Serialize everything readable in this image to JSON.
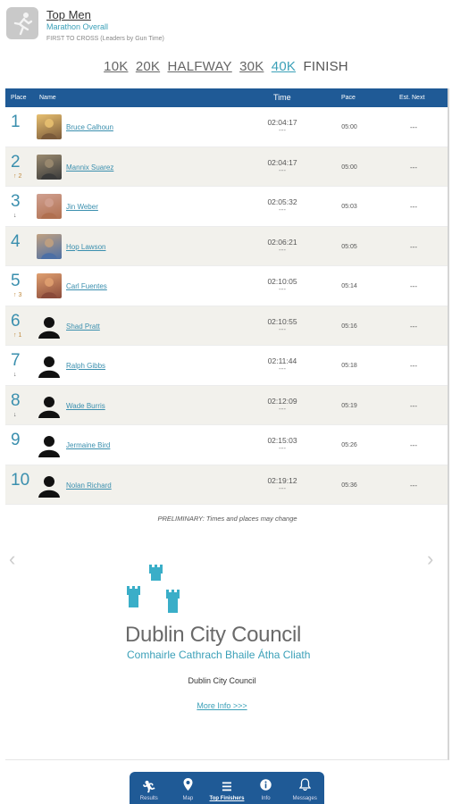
{
  "header": {
    "title": "Top Men",
    "subtitle": "Marathon Overall",
    "note": "FIRST TO CROSS (Leaders by Gun Time)"
  },
  "splits": [
    {
      "label": "10K",
      "state": "link"
    },
    {
      "label": "20K",
      "state": "link"
    },
    {
      "label": "HALFWAY",
      "state": "link"
    },
    {
      "label": "30K",
      "state": "link"
    },
    {
      "label": "40K",
      "state": "active"
    },
    {
      "label": "FINISH",
      "state": "current"
    }
  ],
  "table": {
    "columns": {
      "place": "Place",
      "name": "Name",
      "time": "Time",
      "pace": "Pace",
      "next": "Est. Next"
    },
    "rows": [
      {
        "place": "1",
        "change": "",
        "name": "Bruce Calhoun",
        "time": "02:04:17",
        "sub": "---",
        "pace": "05:00",
        "next": "---",
        "photo": "photo"
      },
      {
        "place": "2",
        "change": "↑ 2",
        "dir": "up",
        "name": "Mannix Suarez",
        "time": "02:04:17",
        "sub": "---",
        "pace": "05:00",
        "next": "---",
        "photo": "photo"
      },
      {
        "place": "3",
        "change": "↓",
        "dir": "down",
        "name": "Jin Weber",
        "time": "02:05:32",
        "sub": "---",
        "pace": "05:03",
        "next": "---",
        "photo": "photo"
      },
      {
        "place": "4",
        "change": "",
        "name": "Hop Lawson",
        "time": "02:06:21",
        "sub": "---",
        "pace": "05:05",
        "next": "---",
        "photo": "photo"
      },
      {
        "place": "5",
        "change": "↑ 3",
        "dir": "up",
        "name": "Carl Fuentes",
        "time": "02:10:05",
        "sub": "---",
        "pace": "05:14",
        "next": "---",
        "photo": "photo"
      },
      {
        "place": "6",
        "change": "↑ 1",
        "dir": "up",
        "name": "Shad Pratt",
        "time": "02:10:55",
        "sub": "---",
        "pace": "05:16",
        "next": "---",
        "photo": "silhouette"
      },
      {
        "place": "7",
        "change": "↓",
        "dir": "down",
        "name": "Ralph Gibbs",
        "time": "02:11:44",
        "sub": "---",
        "pace": "05:18",
        "next": "---",
        "photo": "silhouette"
      },
      {
        "place": "8",
        "change": "↓",
        "dir": "down",
        "name": "Wade Burris",
        "time": "02:12:09",
        "sub": "---",
        "pace": "05:19",
        "next": "---",
        "photo": "silhouette"
      },
      {
        "place": "9",
        "change": "",
        "name": "Jermaine Bird",
        "time": "02:15:03",
        "sub": "---",
        "pace": "05:26",
        "next": "---",
        "photo": "silhouette"
      },
      {
        "place": "10",
        "change": "",
        "name": "Nolan Richard",
        "time": "02:19:12",
        "sub": "---",
        "pace": "05:36",
        "next": "---",
        "photo": "silhouette"
      }
    ]
  },
  "preliminary": "PRELIMINARY: Times and places may change",
  "sponsor": {
    "logo_main": "Dublin City Council",
    "logo_sub": "Comhairle Cathrach Bhaile Átha Cliath",
    "name": "Dublin City Council",
    "more": "More Info >>>"
  },
  "tabs": [
    {
      "label": "Results",
      "icon": "runner-icon"
    },
    {
      "label": "Map",
      "icon": "map-pin-icon"
    },
    {
      "label": "Top Finishers",
      "icon": "list-icon",
      "active": true
    },
    {
      "label": "Info",
      "icon": "info-icon"
    },
    {
      "label": "Messages",
      "icon": "bell-icon"
    }
  ],
  "colors": {
    "header_bar": "#1f5a96",
    "accent": "#3ba0b8",
    "castle": "#3aaec8"
  }
}
